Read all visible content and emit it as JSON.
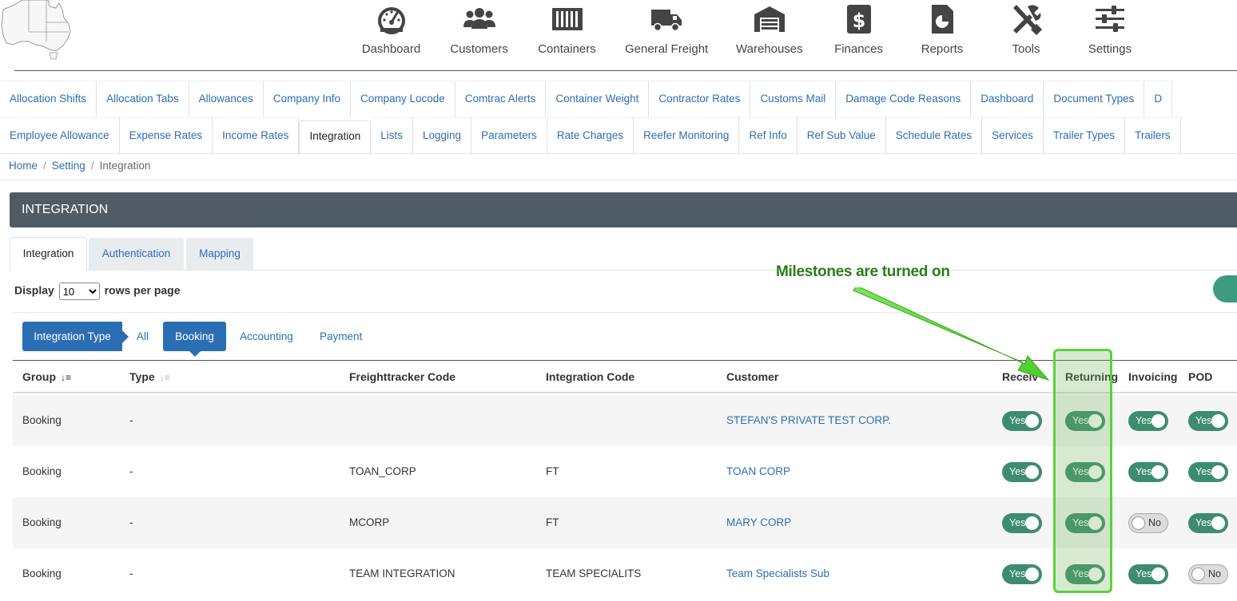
{
  "topnav": {
    "items": [
      {
        "label": "Dashboard",
        "icon": "gauge-icon"
      },
      {
        "label": "Customers",
        "icon": "users-icon"
      },
      {
        "label": "Containers",
        "icon": "container-icon"
      },
      {
        "label": "General Freight",
        "icon": "truck-icon"
      },
      {
        "label": "Warehouses",
        "icon": "warehouse-icon"
      },
      {
        "label": "Finances",
        "icon": "dollar-icon"
      },
      {
        "label": "Reports",
        "icon": "report-icon"
      },
      {
        "label": "Tools",
        "icon": "tools-icon"
      },
      {
        "label": "Settings",
        "icon": "sliders-icon"
      }
    ]
  },
  "settings_tabs": {
    "row1": [
      "Allocation Shifts",
      "Allocation Tabs",
      "Allowances",
      "Company Info",
      "Company Locode",
      "Comtrac Alerts",
      "Container Weight",
      "Contractor Rates",
      "Customs Mail",
      "Damage Code Reasons",
      "Dashboard",
      "Document Types",
      "D"
    ],
    "row2": [
      "Employee Allowance",
      "Expense Rates",
      "Income Rates",
      "Integration",
      "Lists",
      "Logging",
      "Parameters",
      "Rate Charges",
      "Reefer Monitoring",
      "Ref Info",
      "Ref Sub Value",
      "Schedule Rates",
      "Services",
      "Trailer Types",
      "Trailers"
    ],
    "active": "Integration"
  },
  "breadcrumb": {
    "home": "Home",
    "setting": "Setting",
    "current": "Integration",
    "separator": "/"
  },
  "panel": {
    "title": "INTEGRATION"
  },
  "inner_tabs": {
    "integration": "Integration",
    "authentication": "Authentication",
    "mapping": "Mapping"
  },
  "display": {
    "prefix": "Display",
    "value": "10",
    "suffix": "rows per page",
    "options": [
      "10"
    ]
  },
  "filters": {
    "integration_type": "Integration Type",
    "all": "All",
    "booking": "Booking",
    "accounting": "Accounting",
    "payment": "Payment"
  },
  "table": {
    "headers": {
      "group": "Group",
      "type": "Type",
      "freight_code": "Freighttracker Code",
      "integration_code": "Integration Code",
      "customer": "Customer",
      "receiving": "Receiv",
      "returning": "Returning",
      "invoicing": "Invoicing",
      "pod": "POD"
    },
    "rows": [
      {
        "group": "Booking",
        "type": "-",
        "freight_code": "",
        "integration_code": "",
        "customer": "STEFAN'S PRIVATE TEST CORP.",
        "receiving": "Yes",
        "returning": "Yes",
        "invoicing": "Yes",
        "pod": "Yes"
      },
      {
        "group": "Booking",
        "type": "-",
        "freight_code": "TOAN_CORP",
        "integration_code": "FT",
        "customer": "TOAN CORP",
        "receiving": "Yes",
        "returning": "Yes",
        "invoicing": "Yes",
        "pod": "Yes"
      },
      {
        "group": "Booking",
        "type": "-",
        "freight_code": "MCORP",
        "integration_code": "FT",
        "customer": "MARY CORP",
        "receiving": "Yes",
        "returning": "Yes",
        "invoicing": "No",
        "pod": "Yes"
      },
      {
        "group": "Booking",
        "type": "-",
        "freight_code": "TEAM INTEGRATION",
        "integration_code": "TEAM SPECIALITS",
        "customer": "Team Specialists Sub",
        "receiving": "Yes",
        "returning": "Yes",
        "invoicing": "Yes",
        "pod": "No"
      }
    ]
  },
  "annotation": {
    "text": "Milestones are turned on",
    "color": "#58d43b"
  },
  "colors": {
    "brand_blue": "#2c6eb3",
    "panel_header": "#4f5c65",
    "toggle_on": "#3d8c6f"
  }
}
